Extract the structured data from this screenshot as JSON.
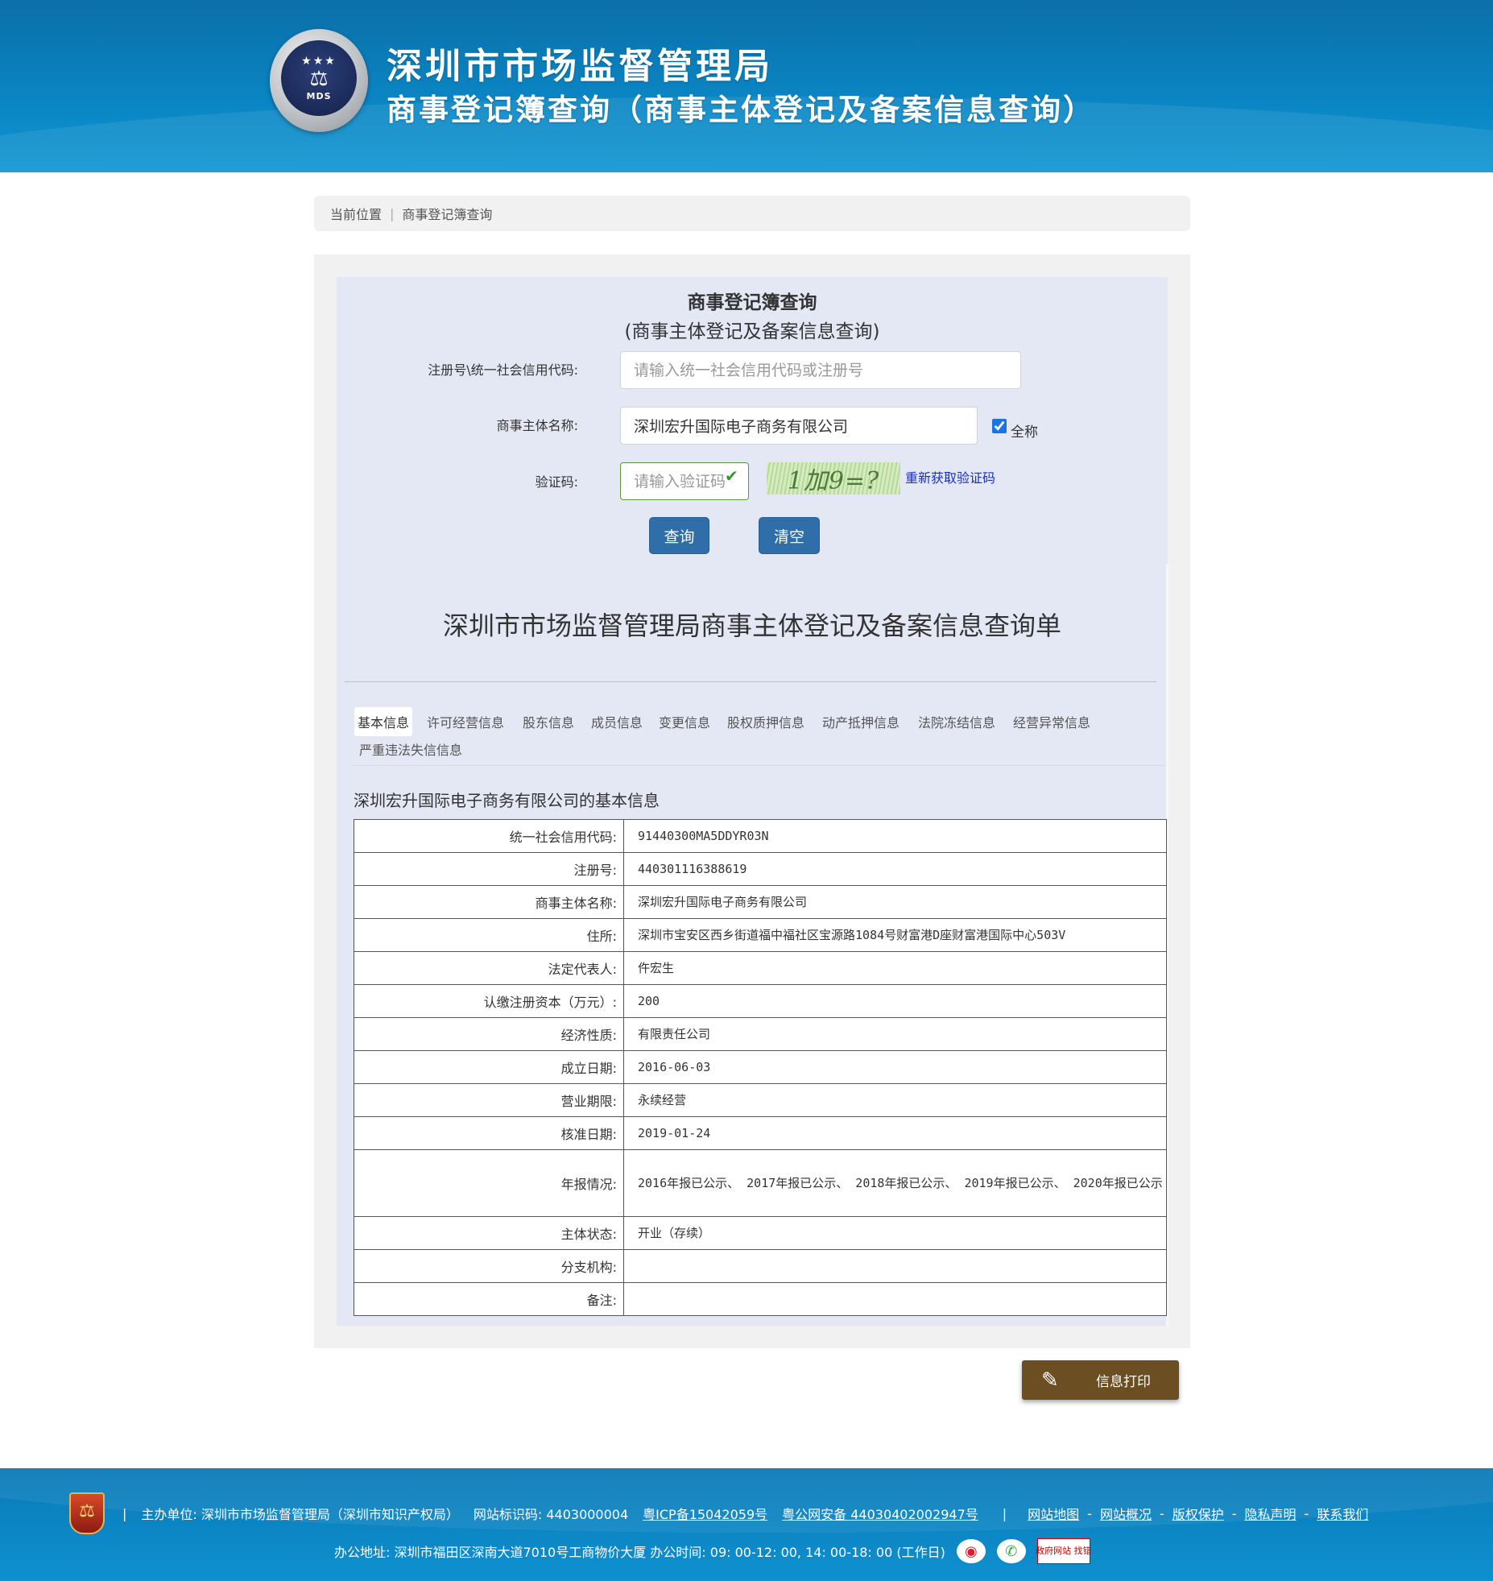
{
  "header": {
    "title1": "深圳市市场监督管理局",
    "title2": "商事登记簿查询（商事主体登记及备案信息查询）",
    "logo_text": "MDS"
  },
  "breadcrumb": {
    "label": "当前位置",
    "separator": "|",
    "current": "商事登记簿查询"
  },
  "form": {
    "title": "商事登记簿查询",
    "subtitle": "(商事主体登记及备案信息查询)",
    "reg_label": "注册号\\统一社会信用代码:",
    "reg_placeholder": "请输入统一社会信用代码或注册号",
    "reg_value": "",
    "name_label": "商事主体名称:",
    "name_value": "深圳宏升国际电子商务有限公司",
    "fullname_label": "全称",
    "fullname_checked": true,
    "captcha_label": "验证码:",
    "captcha_placeholder": "请输入验证码",
    "captcha_image_text": "1加9=?",
    "captcha_refresh": "重新获取验证码",
    "query_button": "查询",
    "clear_button": "清空"
  },
  "result": {
    "title": "深圳市市场监督管理局商事主体登记及备案信息查询单",
    "tabs": [
      {
        "label": "基本信息",
        "active": true
      },
      {
        "label": "许可经营信息",
        "active": false
      },
      {
        "label": "股东信息",
        "active": false
      },
      {
        "label": "成员信息",
        "active": false
      },
      {
        "label": "变更信息",
        "active": false
      },
      {
        "label": "股权质押信息",
        "active": false
      },
      {
        "label": "动产抵押信息",
        "active": false
      },
      {
        "label": "法院冻结信息",
        "active": false
      },
      {
        "label": "经营异常信息",
        "active": false
      },
      {
        "label": "严重违法失信信息",
        "active": false
      }
    ],
    "company_heading": "深圳宏升国际电子商务有限公司的基本信息",
    "rows": [
      {
        "key": "统一社会信用代码:",
        "value": "91440300MA5DDYR03N"
      },
      {
        "key": "注册号:",
        "value": "440301116388619"
      },
      {
        "key": "商事主体名称:",
        "value": "深圳宏升国际电子商务有限公司"
      },
      {
        "key": "住所:",
        "value": "深圳市宝安区西乡街道福中福社区宝源路1084号财富港D座财富港国际中心503V"
      },
      {
        "key": "法定代表人:",
        "value": "仵宏生"
      },
      {
        "key": "认缴注册资本（万元）:",
        "value": "200"
      },
      {
        "key": "经济性质:",
        "value": "有限责任公司"
      },
      {
        "key": "成立日期:",
        "value": "2016-06-03"
      },
      {
        "key": "营业期限:",
        "value": "永续经营"
      },
      {
        "key": "核准日期:",
        "value": "2019-01-24"
      },
      {
        "key": "年报情况:",
        "value": "2016年报已公示、 2017年报已公示、 2018年报已公示、 2019年报已公示、 2020年报已公示"
      },
      {
        "key": "主体状态:",
        "value": "开业（存续）"
      },
      {
        "key": "分支机构:",
        "value": ""
      },
      {
        "key": "备注:",
        "value": ""
      }
    ],
    "print_button": "信息打印"
  },
  "footer": {
    "sep": "|",
    "host": "主办单位: 深圳市市场监督管理局（深圳市知识产权局）",
    "site_id": "网站标识码: 4403000004",
    "icp": "粤ICP备15042059号",
    "police": "粤公网安备 44030402002947号",
    "links": [
      "网站地图",
      "网站概况",
      "版权保护",
      "隐私声明",
      "联系我们"
    ],
    "link_dash": "-",
    "address": "办公地址: 深圳市福田区深南大道7010号工商物价大厦 办公时间: 09: 00-12: 00, 14: 00-18: 00 (工作日)",
    "gov_badge": "政府网站 找错"
  }
}
